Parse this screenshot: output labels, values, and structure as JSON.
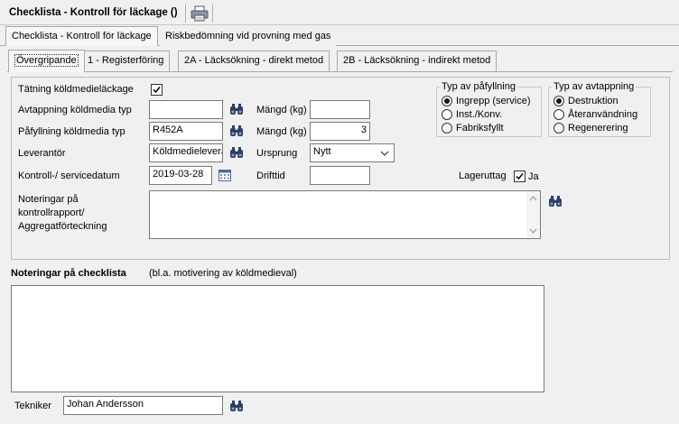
{
  "window": {
    "title": "Checklista - Kontroll för läckage ()",
    "print_icon": "printer-icon"
  },
  "main_tabs": [
    {
      "label": "Checklista - Kontroll för läckage",
      "active": true
    },
    {
      "label": "Riskbedömning vid provning med gas",
      "active": false
    }
  ],
  "sub_tabs": [
    {
      "label": "Övergripande",
      "active": true
    },
    {
      "label": "1 - Registerföring",
      "active": false
    },
    {
      "label": "2A - Läcksökning - direkt metod",
      "active": false
    },
    {
      "label": "2B - Läcksökning - indirekt metod",
      "active": false
    }
  ],
  "form": {
    "tatning_label": "Tätning köldmedieläckage",
    "tatning_checked": true,
    "avtappning_typ_label": "Avtappning köldmedia typ",
    "avtappning_typ_value": "",
    "pafyllning_typ_label": "Påfyllning köldmedia typ",
    "pafyllning_typ_value": "R452A",
    "leverantor_label": "Leverantör",
    "leverantor_value": "Köldmedieleverantör",
    "kontroll_datum_label": "Kontroll-/ servicedatum",
    "kontroll_datum_value": "2019-03-28",
    "noteringar_rapport_label": "Noteringar på kontrollrapport/ Aggregatförteckning",
    "noteringar_rapport_value": "",
    "mangd1_label": "Mängd (kg)",
    "mangd1_value": "",
    "mangd2_label": "Mängd (kg)",
    "mangd2_value": "3",
    "ursprung_label": "Ursprung",
    "ursprung_value": "Nytt",
    "drifttid_label": "Drifttid",
    "drifttid_value": "",
    "lageruttag_label": "Lageruttag",
    "lageruttag_checked": true,
    "lageruttag_ja": "Ja",
    "typ_pafyllning": {
      "title": "Typ av påfyllning",
      "options": [
        {
          "label": "Ingrepp (service)",
          "selected": true
        },
        {
          "label": "Inst./Konv.",
          "selected": false
        },
        {
          "label": "Fabriksfyllt",
          "selected": false
        }
      ]
    },
    "typ_avtappning": {
      "title": "Typ av avtappning",
      "options": [
        {
          "label": "Destruktion",
          "selected": true
        },
        {
          "label": "Återanvändning",
          "selected": false
        },
        {
          "label": "Regenerering",
          "selected": false
        }
      ]
    }
  },
  "checklist_notes": {
    "title": "Noteringar på checklista",
    "hint": "(bl.a. motivering av köldmedieval)",
    "value": ""
  },
  "technician": {
    "label": "Tekniker",
    "value": "Johan Andersson"
  },
  "colors": {
    "background": "#f0f0f0",
    "border": "#a8a8a8",
    "input_border": "#7a7a7a"
  }
}
